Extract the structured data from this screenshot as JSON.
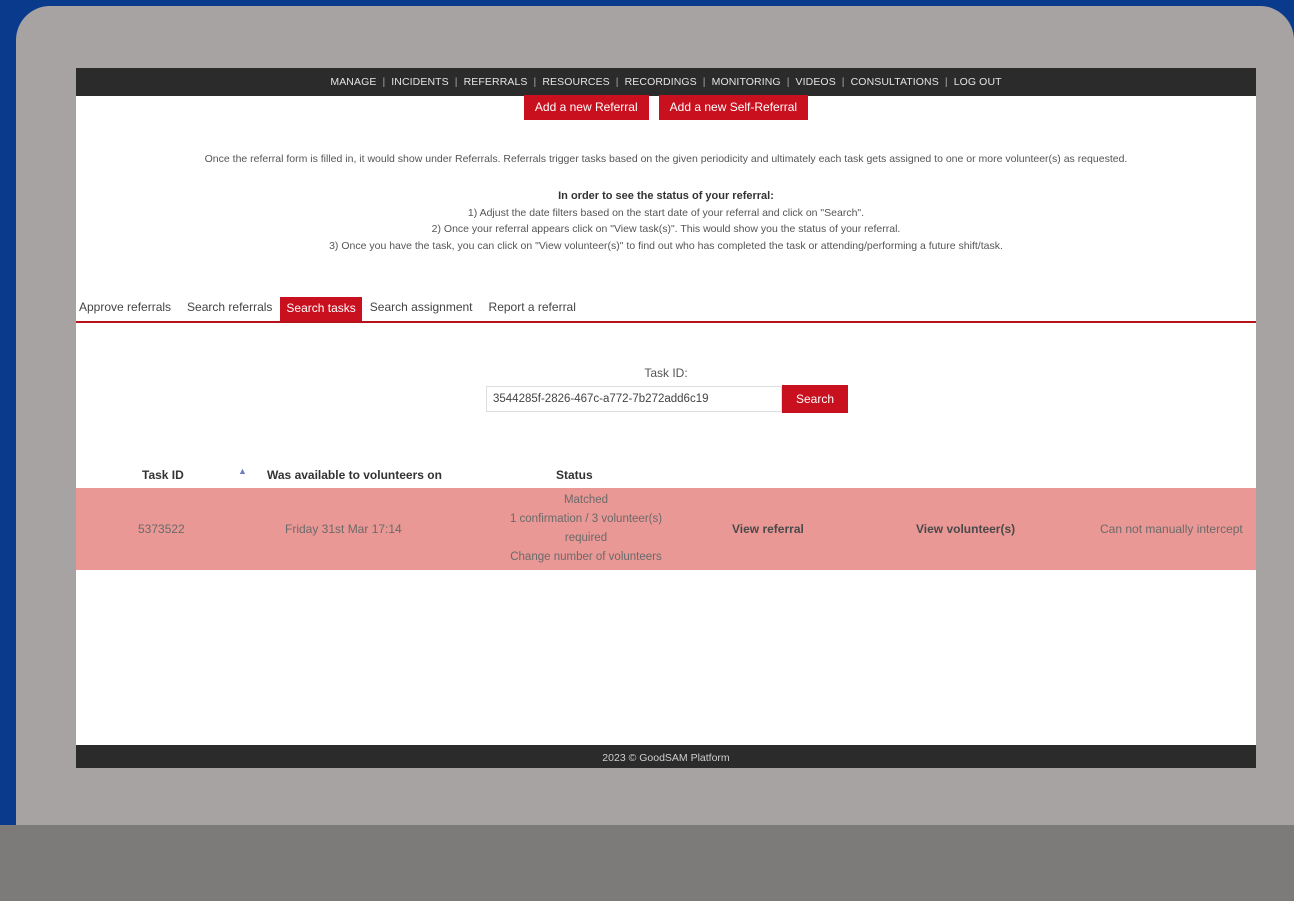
{
  "nav": {
    "items": [
      "MANAGE",
      "INCIDENTS",
      "REFERRALS",
      "RESOURCES",
      "RECORDINGS",
      "MONITORING",
      "VIDEOS",
      "CONSULTATIONS",
      "LOG OUT"
    ],
    "separator": "|"
  },
  "actions": {
    "add_referral": "Add a new Referral",
    "add_self_referral": "Add a new Self-Referral"
  },
  "intro": "Once the referral form is filled in, it would show under Referrals. Referrals trigger tasks based on the given periodicity and ultimately each task gets assigned to one or more volunteer(s) as requested.",
  "steps": {
    "heading": "In order to see the status of your referral:",
    "items": [
      "1) Adjust the date filters based on the start date of your referral and click on \"Search\".",
      "2) Once your referral appears click on \"View task(s)\". This would show you the status of your referral.",
      "3) Once you have the task, you can click on \"View volunteer(s)\" to find out who has completed the task or attending/performing a future shift/task."
    ]
  },
  "tabs": [
    {
      "label": "Approve referrals",
      "active": false
    },
    {
      "label": "Search referrals",
      "active": false
    },
    {
      "label": "Search tasks",
      "active": true
    },
    {
      "label": "Search assignment",
      "active": false
    },
    {
      "label": "Report a referral",
      "active": false
    }
  ],
  "search": {
    "label": "Task ID:",
    "value": "3544285f-2826-467c-a772-7b272add6c19",
    "button": "Search"
  },
  "table": {
    "headers": {
      "task_id": "Task ID",
      "sort_icon": "▲",
      "available": "Was available to volunteers on",
      "status": "Status"
    },
    "rows": [
      {
        "task_id": "5373522",
        "available": "Friday 31st Mar 17:14",
        "status_lines": [
          "Matched",
          "1 confirmation / 3 volunteer(s)",
          "required",
          "Change number of volunteers"
        ],
        "view_referral": "View referral",
        "view_volunteers": "View volunteer(s)",
        "intercept": "Can not manually intercept"
      }
    ]
  },
  "footer": "2023 © GoodSAM Platform",
  "colors": {
    "accent_red": "#c8101e",
    "row_highlight": "#e99895",
    "nav_bg": "#2b2b2b"
  }
}
